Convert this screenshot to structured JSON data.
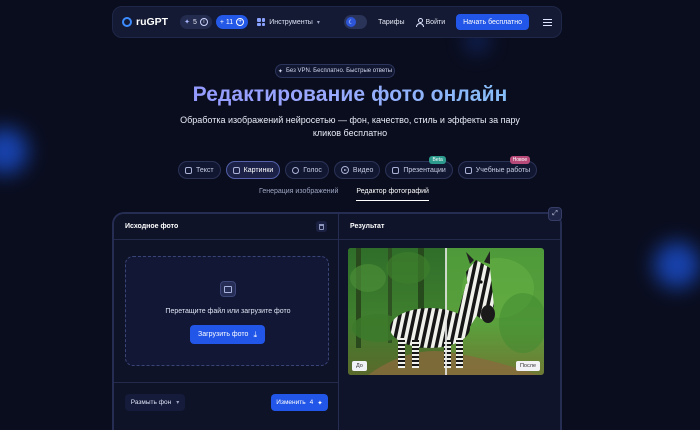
{
  "header": {
    "logo_text": "ruGPT",
    "credits_count": "5",
    "plus_label": "+ 11",
    "tools_label": "Инструменты",
    "pricing_label": "Тарифы",
    "login_label": "Войти",
    "cta_label": "Начать бесплатно"
  },
  "hero": {
    "pill_text": "Без VPN. Бесплатно. Быстрые ответы",
    "title": "Редактирование фото онлайн",
    "subtitle": "Обработка изображений нейросетью — фон, качество, стиль и эффекты за пару кликов бесплатно"
  },
  "categories": [
    {
      "label": "Текст",
      "icon": "text-icon"
    },
    {
      "label": "Картинки",
      "icon": "image-icon"
    },
    {
      "label": "Голос",
      "icon": "voice-icon"
    },
    {
      "label": "Видео",
      "icon": "video-icon"
    },
    {
      "label": "Презентации",
      "icon": "presentation-icon",
      "badge": "Beta"
    },
    {
      "label": "Учебные работы",
      "icon": "study-icon",
      "badge": "Новое"
    }
  ],
  "active_category": "Картинки",
  "subtabs": [
    "Генерация изображений",
    "Редактор фотографий"
  ],
  "active_subtab": "Редактор фотографий",
  "editor": {
    "source_title": "Исходное фото",
    "drop_text": "Перетащите файл или загрузите фото",
    "upload_label": "Загрузить фото",
    "mode_label": "Размыть фон",
    "change_label": "Изменить",
    "change_cost": "4",
    "result_title": "Результат",
    "before_label": "До",
    "after_label": "После"
  },
  "colors": {
    "background": "#0a0d1e",
    "accent": "#2156e8",
    "title_gradient_start": "#8b86ff",
    "title_gradient_end": "#72d4ef"
  }
}
